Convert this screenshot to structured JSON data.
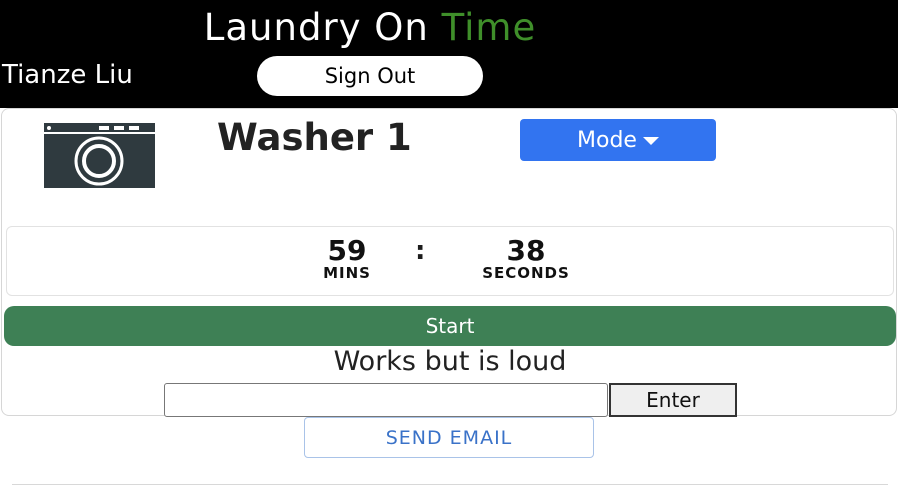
{
  "header": {
    "title_main": "Laundry On ",
    "title_accent": "Time",
    "accent_color": "#3f8f2a",
    "user_name": "Tianze Liu",
    "sign_out_label": "Sign Out"
  },
  "machine": {
    "icon": "washing-machine-icon",
    "name": "Washer 1",
    "mode_label": "Mode",
    "mode_color": "#3274f0"
  },
  "timer": {
    "minutes": "59",
    "minutes_label": "MINS",
    "separator": ":",
    "seconds": "38",
    "seconds_label": "SECONDS"
  },
  "actions": {
    "start_label": "Start",
    "start_color": "#3e8055",
    "status_note": "Works but is loud",
    "note_input_value": "",
    "enter_label": "Enter",
    "send_email_label": "SEND EMAIL"
  }
}
